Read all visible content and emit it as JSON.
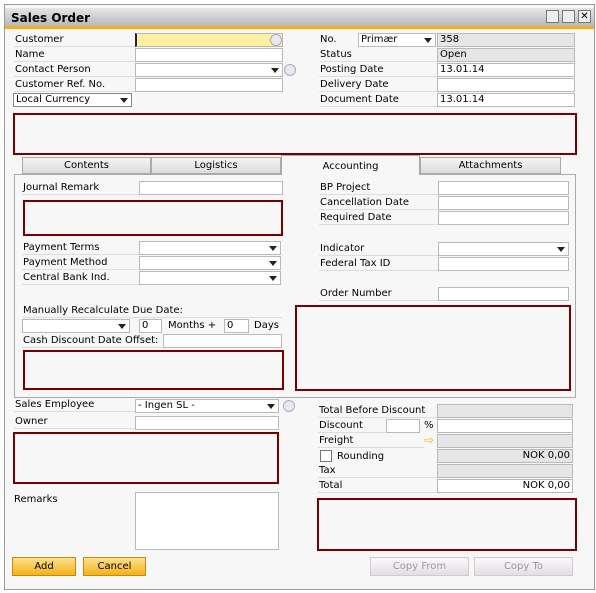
{
  "window": {
    "title": "Sales Order"
  },
  "header": {
    "customer_label": "Customer",
    "customer_value": "",
    "name_label": "Name",
    "contact_label": "Contact Person",
    "ref_label": "Customer Ref. No.",
    "currency": "Local Currency",
    "no_label": "No.",
    "series": "Primær",
    "no_value": "358",
    "status_label": "Status",
    "status_value": "Open",
    "posting_label": "Posting Date",
    "posting_value": "13.01.14",
    "delivery_label": "Delivery Date",
    "delivery_value": "",
    "document_label": "Document Date",
    "document_value": "13.01.14"
  },
  "tabs": [
    {
      "label": "Contents"
    },
    {
      "label": "Logistics"
    },
    {
      "label": "Accounting",
      "active": true
    },
    {
      "label": "Attachments"
    }
  ],
  "accounting": {
    "journal_remark": "Journal Remark",
    "payment_terms": "Payment Terms",
    "payment_method": "Payment Method",
    "central_bank": "Central Bank Ind.",
    "recalc": "Manually Recalculate Due Date:",
    "months_value": "0",
    "months_label": "Months +",
    "days_value": "0",
    "days_label": "Days",
    "cash_discount": "Cash Discount Date Offset:",
    "bp_project": "BP Project",
    "cancellation": "Cancellation Date",
    "required": "Required Date",
    "indicator": "Indicator",
    "federal_tax": "Federal Tax ID",
    "order_number": "Order Number"
  },
  "footer": {
    "sales_employee_label": "Sales Employee",
    "sales_employee_value": "- Ingen SL -",
    "owner_label": "Owner",
    "remarks_label": "Remarks",
    "total_before_discount": "Total Before Discount",
    "discount": "Discount",
    "percent": "%",
    "freight": "Freight",
    "rounding": "Rounding",
    "rounding_value": "NOK 0,00",
    "tax": "Tax",
    "total": "Total",
    "total_value": "NOK 0,00"
  },
  "buttons": {
    "add": "Add",
    "cancel": "Cancel",
    "copy_from": "Copy From",
    "copy_to": "Copy To"
  },
  "colors": {
    "accent": "#f3b21b",
    "highlight_box": "#7a0000",
    "focus_field": "#fdf0a0"
  }
}
